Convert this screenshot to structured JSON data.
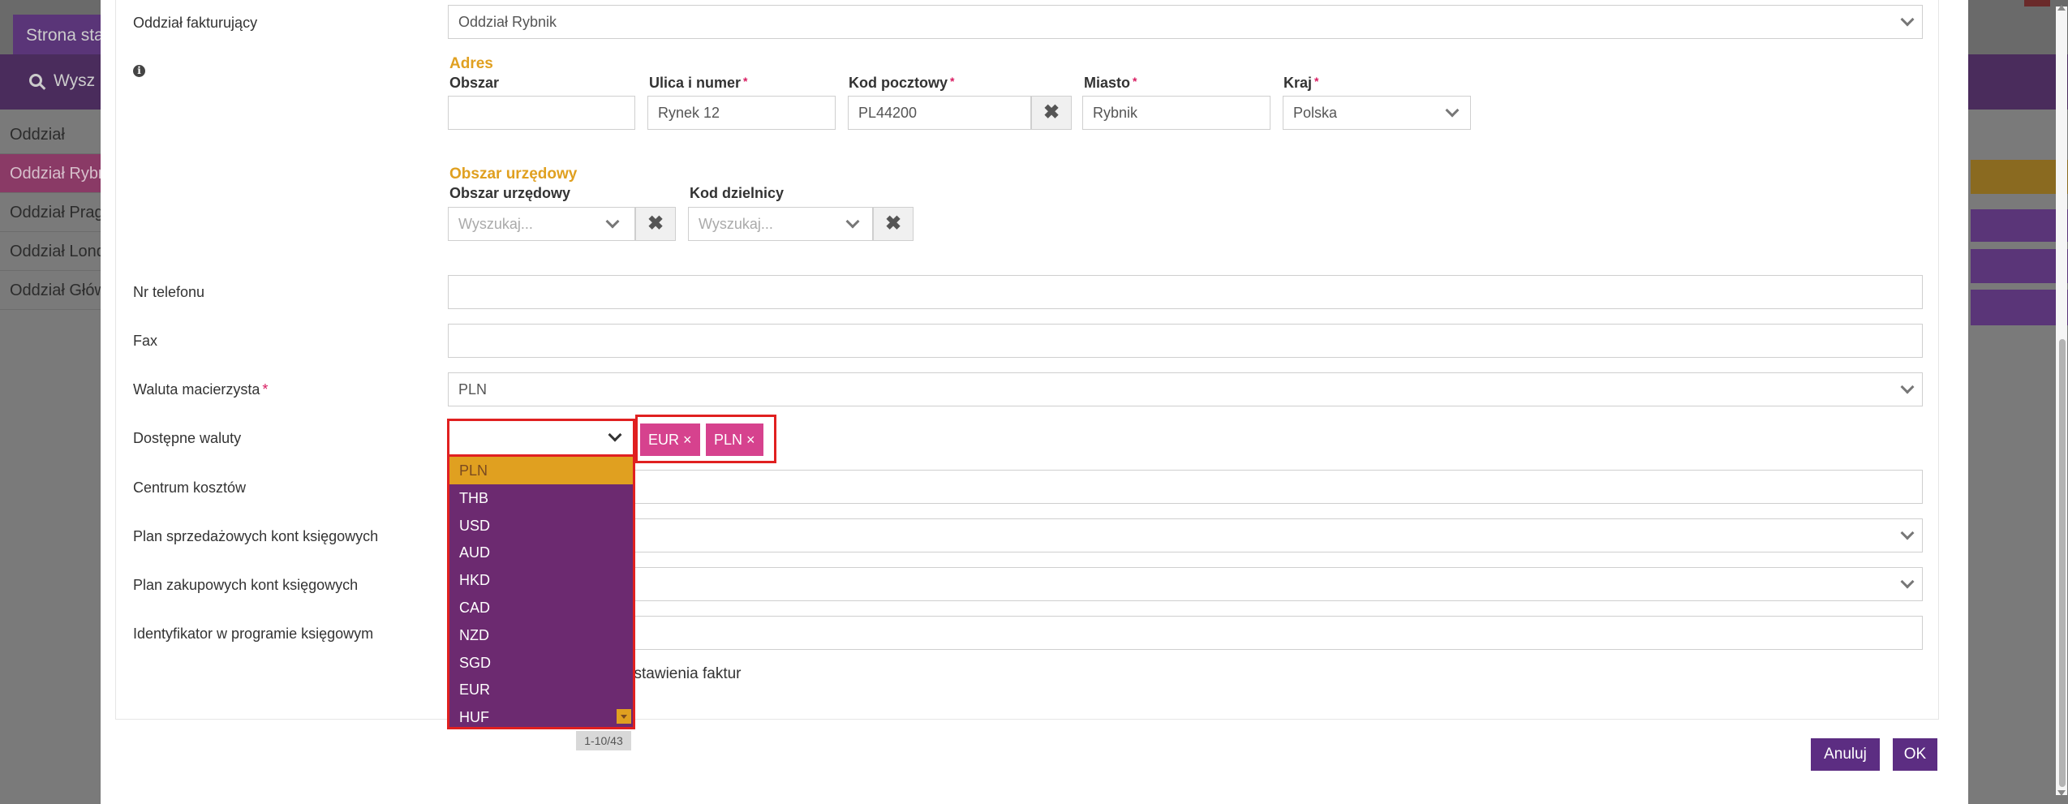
{
  "background": {
    "home_tab": "Strona sta",
    "search_text": "Wysz",
    "list_items": [
      "Oddział",
      "Oddział Rybn",
      "Oddział Prag",
      "Oddział Lond",
      "Oddział Głów"
    ]
  },
  "form": {
    "billing_branch": {
      "label": "Oddział fakturujący",
      "value": "Oddział Rybnik"
    },
    "address": {
      "section_title": "Adres",
      "area_label": "Obszar",
      "area_value": "",
      "street_label": "Ulica i numer",
      "street_value": "Rynek 12",
      "postal_label": "Kod pocztowy",
      "postal_value": "PL44200",
      "city_label": "Miasto",
      "city_value": "Rybnik",
      "country_label": "Kraj",
      "country_value": "Polska"
    },
    "official_area": {
      "section_title": "Obszar urzędowy",
      "area_label": "Obszar urzędowy",
      "area_placeholder": "Wyszukaj...",
      "district_label": "Kod dzielnicy",
      "district_placeholder": "Wyszukaj..."
    },
    "phone": {
      "label": "Nr telefonu",
      "value": ""
    },
    "fax": {
      "label": "Fax",
      "value": ""
    },
    "parent_currency": {
      "label": "Waluta macierzysta",
      "value": "PLN"
    },
    "available_currencies": {
      "label": "Dostępne waluty",
      "selected_tags": [
        "EUR ×",
        "PLN ×"
      ],
      "options": [
        "PLN",
        "THB",
        "USD",
        "AUD",
        "HKD",
        "CAD",
        "NZD",
        "SGD",
        "EUR",
        "HUF"
      ],
      "highlighted": "PLN",
      "pager": "1-10/43"
    },
    "cost_center": {
      "label": "Centrum kosztów"
    },
    "sales_accounts_plan": {
      "label": "Plan sprzedażowych kont księgowych"
    },
    "purchase_accounts_plan": {
      "label": "Plan zakupowych kont księgowych"
    },
    "accounting_id": {
      "label": "Identyfikator w programie księgowym"
    },
    "invoice_checkbox_text": "ystawienia faktur"
  },
  "footer": {
    "cancel": "Anuluj",
    "ok": "OK"
  },
  "colors": {
    "accent_purple": "#5c2d82",
    "accent_gold": "#e0a020",
    "tag_pink": "#d6428e",
    "required_red": "#d81b60"
  }
}
